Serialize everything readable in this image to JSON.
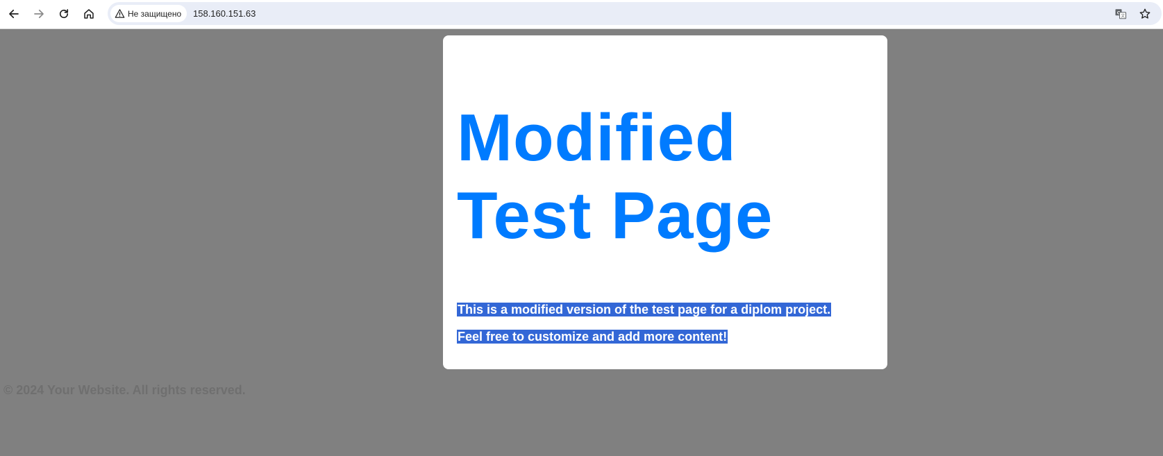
{
  "browser": {
    "security_label": "Не защищено",
    "url": "158.160.151.63",
    "icons": [
      "back-icon",
      "forward-icon",
      "reload-icon",
      "home-icon",
      "warning-icon",
      "translate-icon",
      "bookmark-star-icon"
    ]
  },
  "page": {
    "heading": "Modified Test Page",
    "paragraphs": [
      "This is a modified version of the test page for a diplom project.",
      "Feel free to customize and add more content!"
    ],
    "footer": "© 2024 Your Website. All rights reserved.",
    "colors": {
      "heading": "#007bff",
      "background": "#808080",
      "selection": "#3367d6"
    }
  }
}
